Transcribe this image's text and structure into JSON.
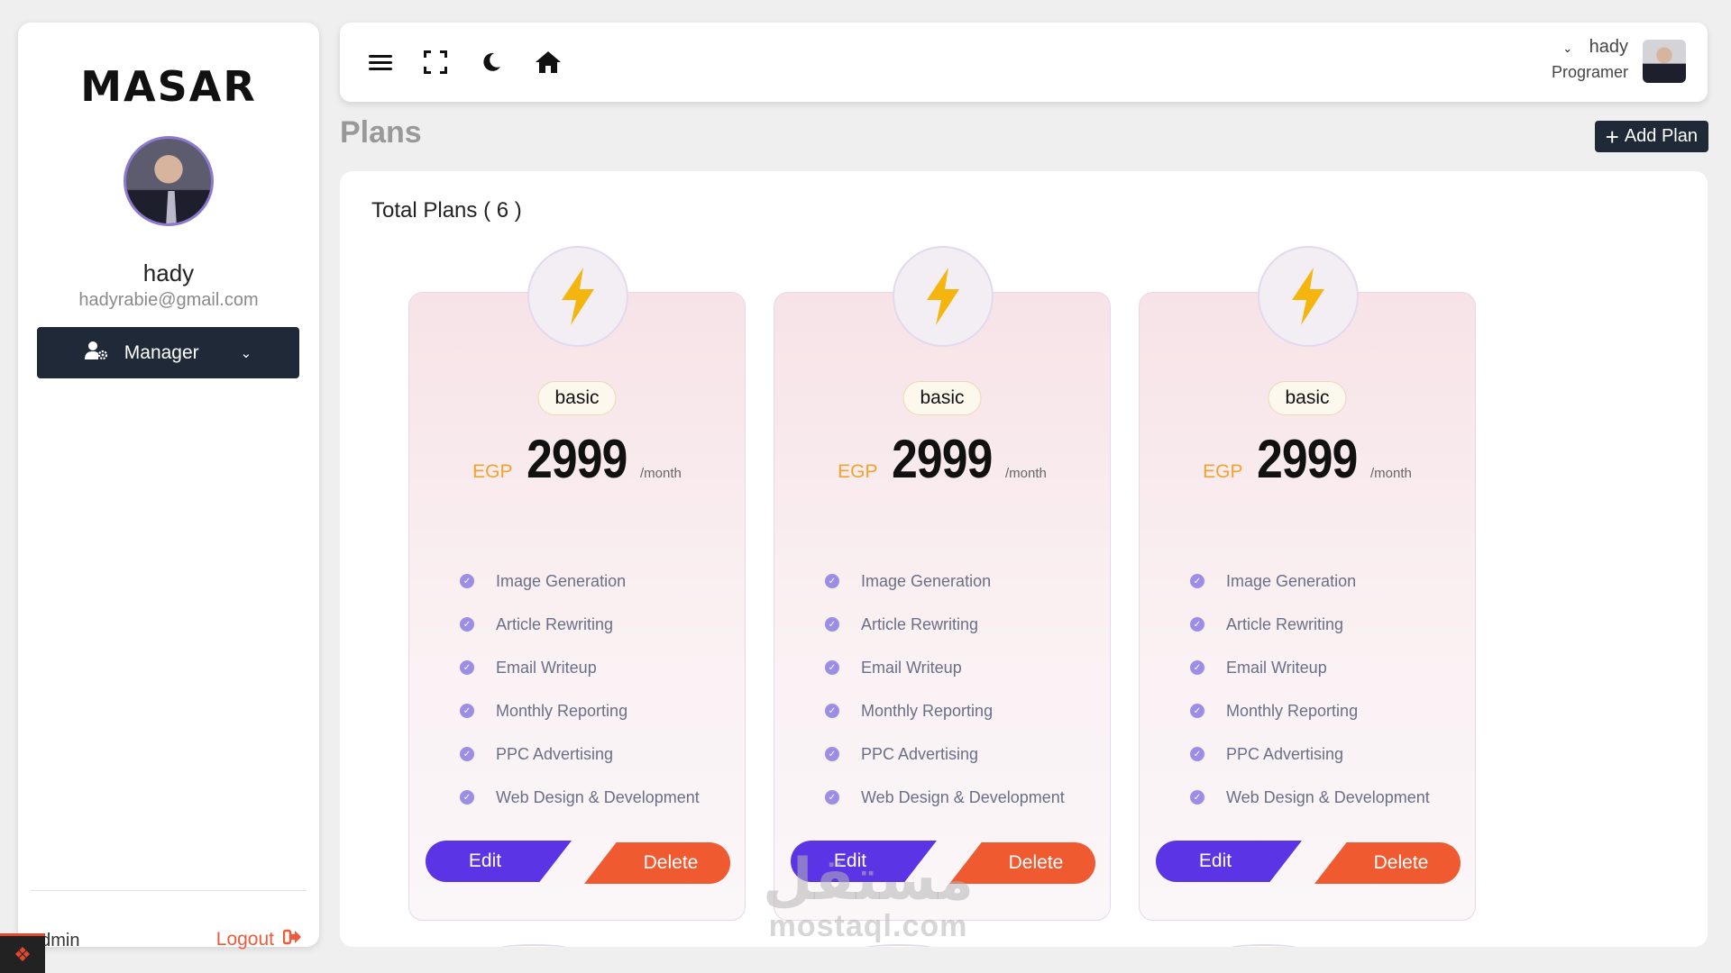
{
  "sidebar": {
    "logo": "MASAR",
    "profile": {
      "name": "hady",
      "email": "hadyrabie@gmail.com"
    },
    "role_select": {
      "label": "Manager",
      "icon": "user-gear-icon"
    },
    "footer": {
      "user": "admin",
      "logout_label": "Logout"
    }
  },
  "topbar": {
    "icons": [
      "menu-icon",
      "fullscreen-icon",
      "moon-icon",
      "home-icon"
    ],
    "user": {
      "name": "hady",
      "role": "Programer"
    }
  },
  "page": {
    "title": "Plans",
    "add_button": "Add Plan",
    "total_plans": "Total Plans ( 6 )"
  },
  "plans": [
    {
      "name": "basic",
      "currency": "EGP",
      "price": "2999",
      "period": "/month",
      "features": [
        "Image Generation",
        "Article Rewriting",
        "Email Writeup",
        "Monthly Reporting",
        "PPC Advertising",
        "Web Design & Development"
      ],
      "edit_label": "Edit",
      "delete_label": "Delete"
    },
    {
      "name": "basic",
      "currency": "EGP",
      "price": "2999",
      "period": "/month",
      "features": [
        "Image Generation",
        "Article Rewriting",
        "Email Writeup",
        "Monthly Reporting",
        "PPC Advertising",
        "Web Design & Development"
      ],
      "edit_label": "Edit",
      "delete_label": "Delete"
    },
    {
      "name": "basic",
      "currency": "EGP",
      "price": "2999",
      "period": "/month",
      "features": [
        "Image Generation",
        "Article Rewriting",
        "Email Writeup",
        "Monthly Reporting",
        "PPC Advertising",
        "Web Design & Development"
      ],
      "edit_label": "Edit",
      "delete_label": "Delete"
    }
  ],
  "watermark": {
    "arabic": "مستقل",
    "latin": "mostaql.com"
  },
  "colors": {
    "accent_dark": "#1f2937",
    "edit": "#5b34e6",
    "delete": "#f05a30",
    "bolt": "#f5b50f",
    "logout": "#f05a3a"
  }
}
